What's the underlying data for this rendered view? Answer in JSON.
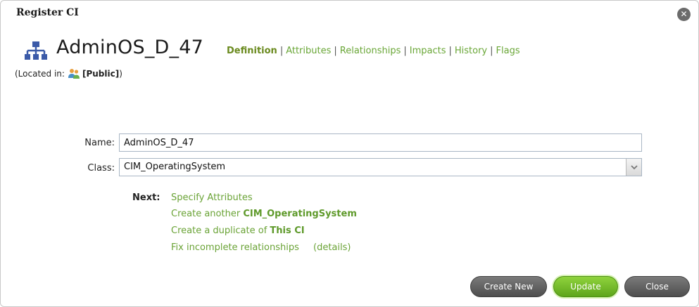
{
  "dialog": {
    "title": "Register CI",
    "close_glyph": "✕"
  },
  "ci": {
    "icon": "network-topology-icon",
    "name": "AdminOS_D_47",
    "located_prefix": "(Located in:",
    "location_icon": "users-group-icon",
    "location": "[Public]",
    "located_suffix": ")"
  },
  "tabs": [
    {
      "label": "Definition",
      "active": true
    },
    {
      "label": "Attributes"
    },
    {
      "label": "Relationships"
    },
    {
      "label": "Impacts"
    },
    {
      "label": "History"
    },
    {
      "label": "Flags"
    }
  ],
  "tab_separator": "|",
  "form": {
    "name_label": "Name:",
    "name_value": "AdminOS_D_47",
    "class_label": "Class:",
    "class_value": "CIM_OperatingSystem"
  },
  "next": {
    "label": "Next:",
    "specify_attributes": "Specify Attributes",
    "create_another_prefix": "Create another",
    "create_another_class": "CIM_OperatingSystem",
    "duplicate_prefix": "Create a duplicate of",
    "duplicate_target": "This CI",
    "fix_relationships": "Fix incomplete relationships",
    "details": "(details)"
  },
  "buttons": {
    "create_new": "Create New",
    "update": "Update",
    "close": "Close"
  },
  "colors": {
    "link_green": "#6aa336",
    "update_green": "#6fbc25",
    "button_gray": "#5f5f5f"
  }
}
